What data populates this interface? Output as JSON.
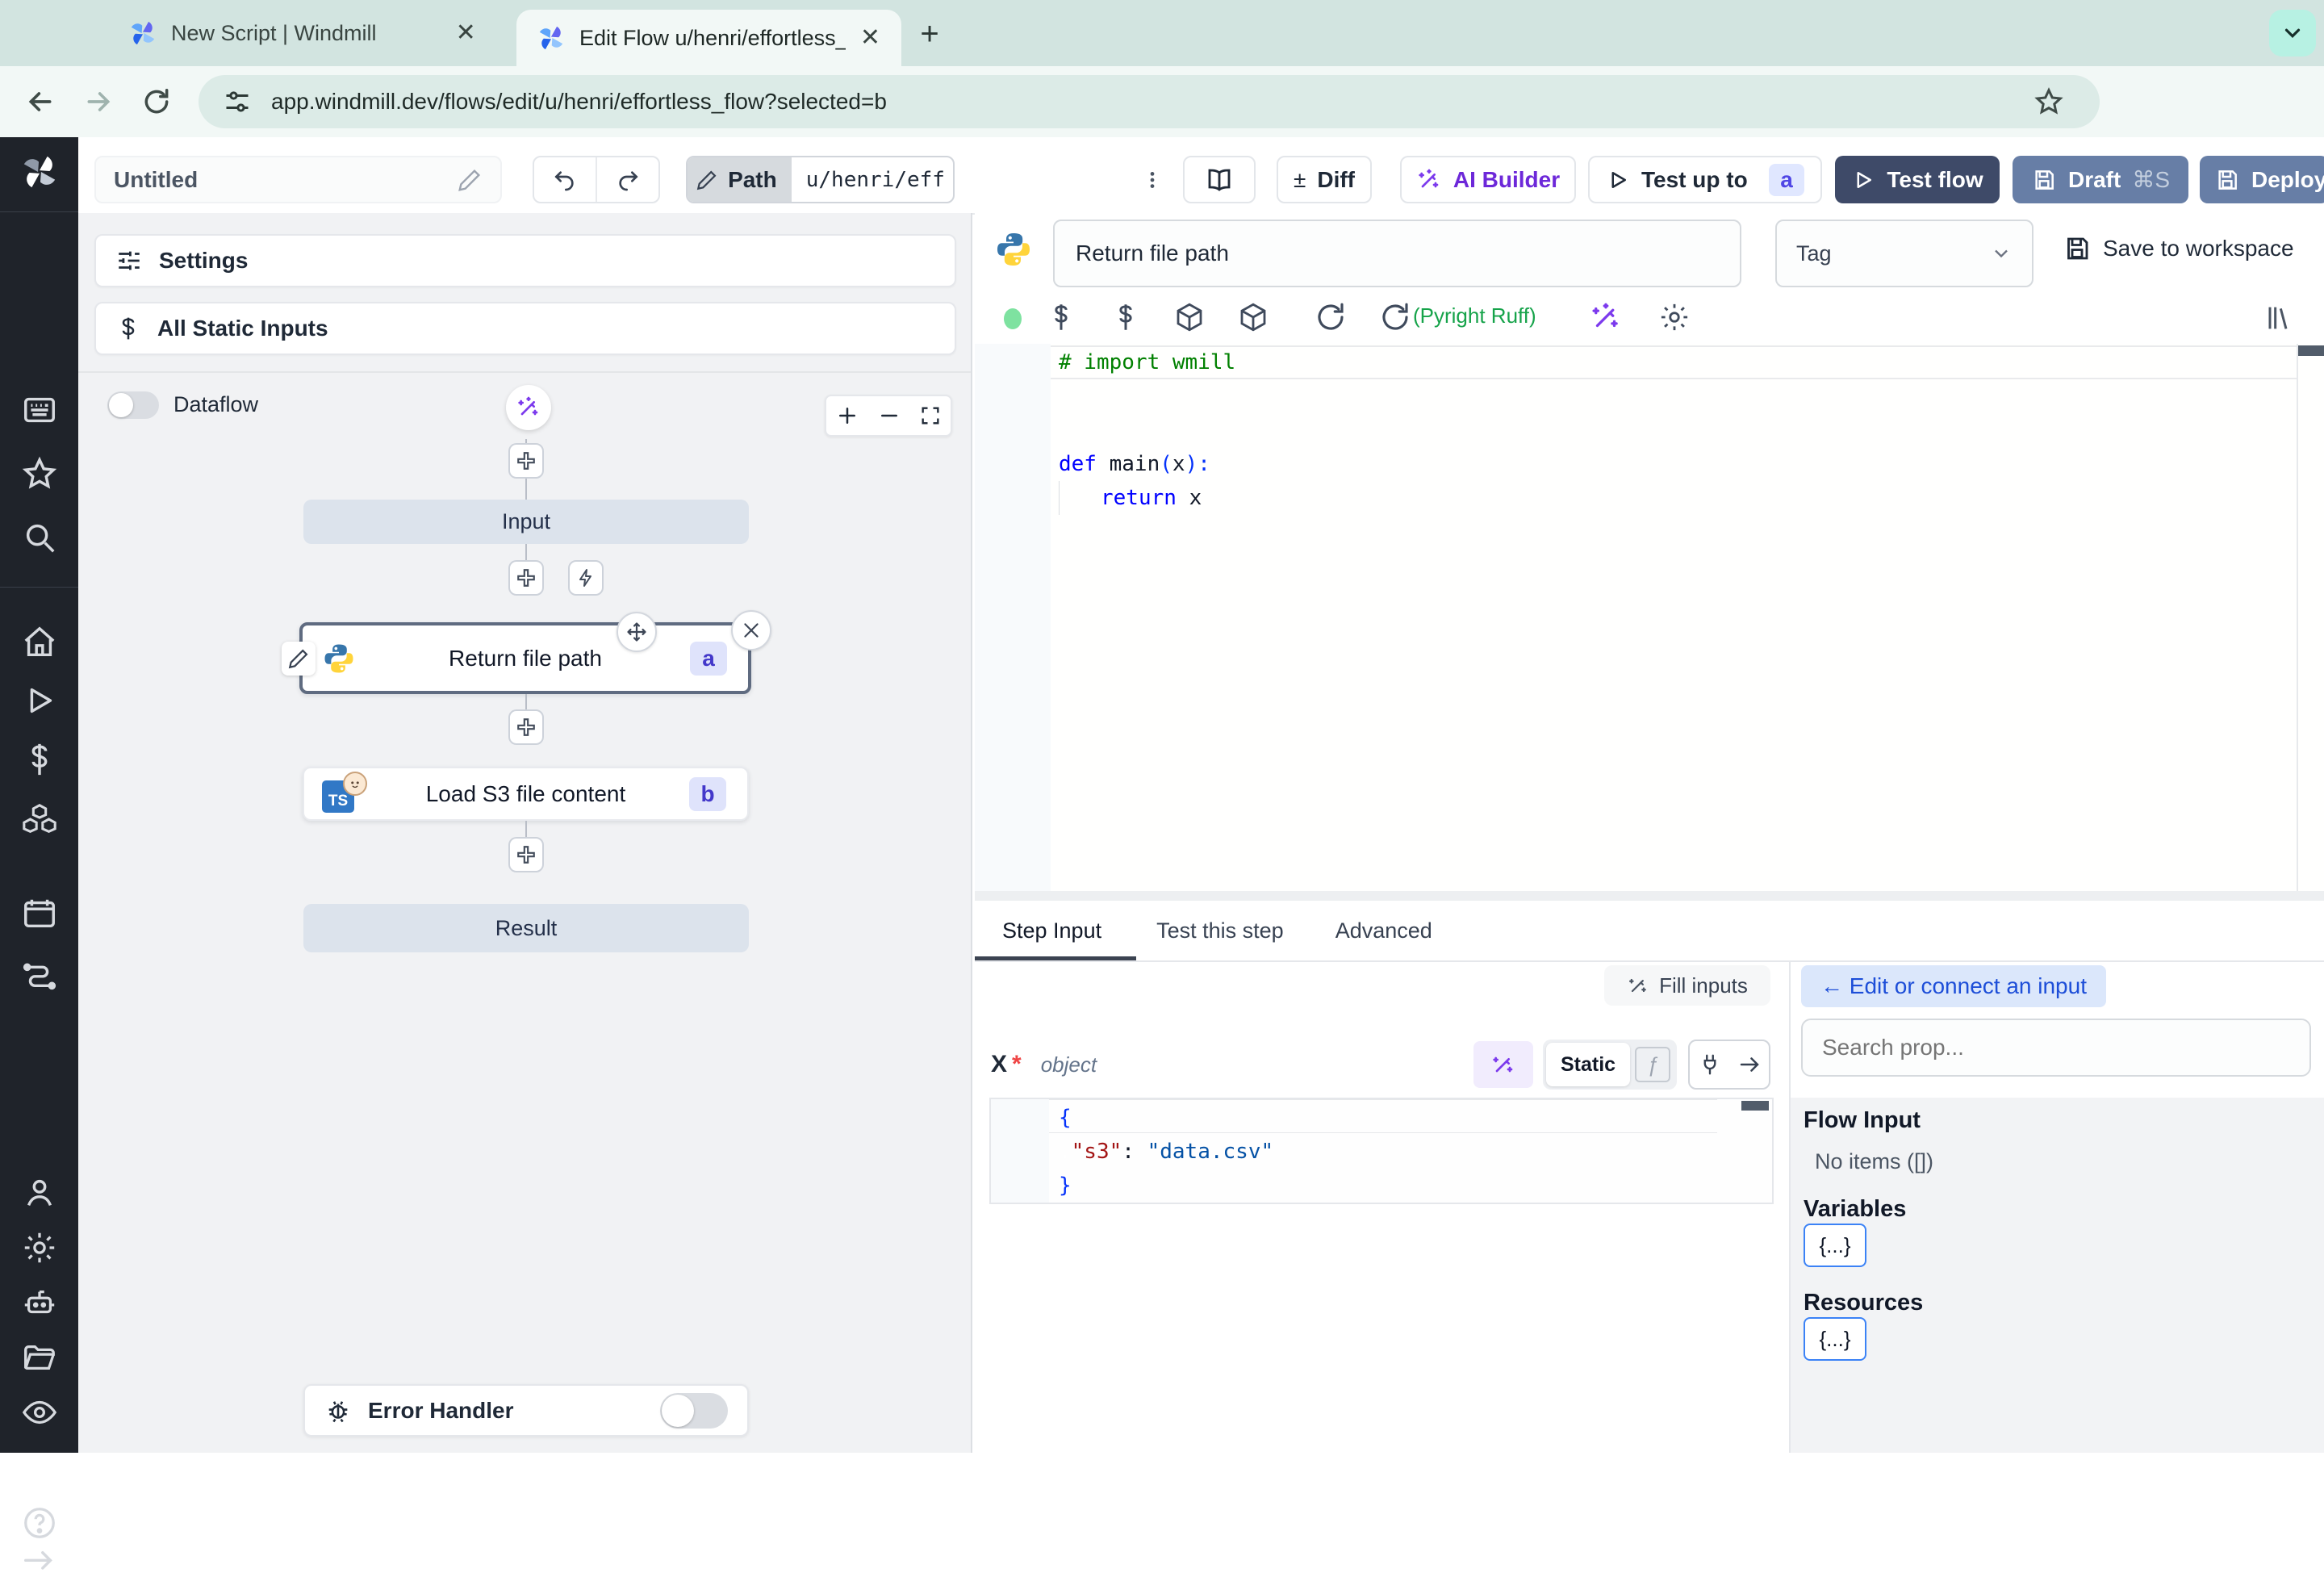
{
  "browser": {
    "tab1": "New Script | Windmill",
    "tab2": "Edit Flow u/henri/effortless_fl",
    "url": "app.windmill.dev/flows/edit/u/henri/effortless_flow?selected=b"
  },
  "header": {
    "name": "Untitled",
    "path_label": "Path",
    "path_value": "u/henri/eff",
    "diff": "Diff",
    "ai_builder": "AI Builder",
    "test_up_to": "Test up to",
    "test_up_to_badge": "a",
    "test_flow": "Test flow",
    "draft": "Draft",
    "draft_shortcut": "⌘S",
    "deploy": "Deploy"
  },
  "flow": {
    "settings": "Settings",
    "all_static_inputs": "All Static Inputs",
    "dataflow": "Dataflow",
    "input_node": "Input",
    "step_a_label": "Return file path",
    "badge_a": "a",
    "step_b_label": "Load S3 file content",
    "badge_b": "b",
    "ts_label": "TS",
    "result_node": "Result",
    "error_handler": "Error Handler"
  },
  "editor": {
    "step_name": "Return file path",
    "tag_placeholder": "Tag",
    "save": "Save to workspace",
    "lint": "(Pyright Ruff)",
    "code": {
      "l1": "# import wmill",
      "kw_def": "def",
      "fn": " main",
      "p1": "(",
      "arg": "x",
      "p2": "):",
      "kw_return": "return",
      "ret_arg": " x"
    }
  },
  "tabs": {
    "t1": "Step Input",
    "t2": "Test this step",
    "t3": "Advanced"
  },
  "step": {
    "fill": "Fill inputs",
    "prop": "x",
    "req": "*",
    "type": "object",
    "static": "Static",
    "json": {
      "l1": "{",
      "key": "\"s3\"",
      "colon": ": ",
      "val": "\"data.csv\"",
      "l3": "}"
    }
  },
  "connect": {
    "button": "← Edit or connect an input",
    "search_placeholder": "Search prop...",
    "flow_input": "Flow Input",
    "no_items": "No items ([])",
    "variables": "Variables",
    "resources": "Resources",
    "chip": "{...}"
  },
  "glyphs": {
    "plusminus": "±",
    "dollar": "$",
    "fn": "ƒ"
  },
  "colors": {
    "accent_purple": "#7c3aed",
    "test_flow_bg": "#3e4a68",
    "slate_button_bg": "#677ea6",
    "badge_bg": "#dfe3fb",
    "badge_text": "#4338ca",
    "lint_green": "#16a34a",
    "status_green": "#7ee2a0",
    "connect_blue": "#1d4ed8"
  }
}
